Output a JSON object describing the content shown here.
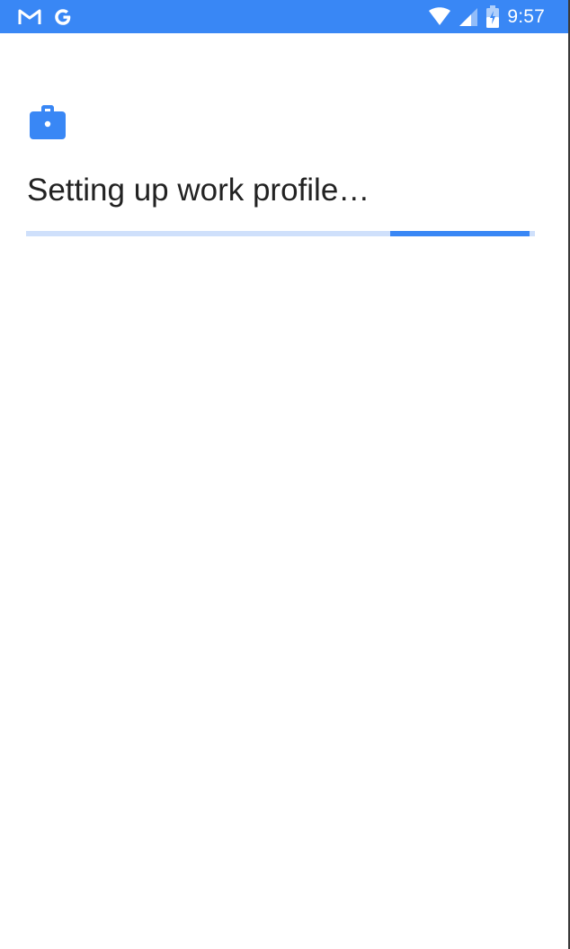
{
  "status_bar": {
    "time": "9:57",
    "background_color": "#3987f5",
    "left_icons": [
      "gmail-icon",
      "google-icon"
    ],
    "right_icons": [
      "wifi-icon",
      "cell-signal-icon",
      "battery-icon"
    ]
  },
  "main": {
    "icon": "briefcase-icon",
    "icon_color": "#3987f5",
    "title": "Setting up work profile…",
    "progress": {
      "type": "indeterminate",
      "segment_start": 0.715,
      "segment_end": 0.99,
      "track_color": "#cfe0fb",
      "fill_color": "#3987f5"
    }
  }
}
